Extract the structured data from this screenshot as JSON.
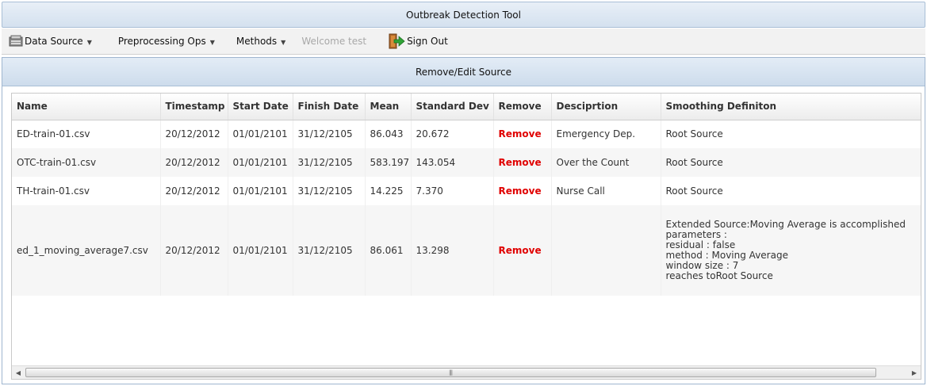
{
  "app": {
    "title": "Outbreak Detection Tool"
  },
  "menu": {
    "data_source": "Data Source",
    "preprocessing": "Preprocessing Ops",
    "methods": "Methods",
    "welcome": "Welcome test",
    "sign_out": "Sign Out",
    "icons": {
      "data_source": "database-icon",
      "sign_out": "exit-door-icon"
    }
  },
  "panel": {
    "title": "Remove/Edit Source"
  },
  "table": {
    "columns": [
      "Name",
      "Timestamp",
      "Start Date",
      "Finish Date",
      "Mean",
      "Standard Dev",
      "Remove",
      "Desciprtion",
      "Smoothing Definiton"
    ],
    "rows": [
      {
        "name": "ED-train-01.csv",
        "timestamp": "20/12/2012",
        "start": "01/01/2101",
        "finish": "31/12/2105",
        "mean": "86.043",
        "std": "20.672",
        "remove": "Remove",
        "description": "Emergency Dep.",
        "smoothing": [
          "Root Source"
        ]
      },
      {
        "name": "OTC-train-01.csv",
        "timestamp": "20/12/2012",
        "start": "01/01/2101",
        "finish": "31/12/2105",
        "mean": "583.197",
        "std": "143.054",
        "remove": "Remove",
        "description": "Over the Count",
        "smoothing": [
          "Root Source"
        ]
      },
      {
        "name": "TH-train-01.csv",
        "timestamp": "20/12/2012",
        "start": "01/01/2101",
        "finish": "31/12/2105",
        "mean": "14.225",
        "std": "7.370",
        "remove": "Remove",
        "description": "Nurse Call",
        "smoothing": [
          "Root Source"
        ]
      },
      {
        "name": "ed_1_moving_average7.csv",
        "timestamp": "20/12/2012",
        "start": "01/01/2101",
        "finish": "31/12/2105",
        "mean": "86.061",
        "std": "13.298",
        "remove": "Remove",
        "description": "",
        "smoothing": [
          "Extended Source:Moving Average is accomplished",
          "parameters :",
          "residual : false",
          "method : Moving Average",
          "window size : 7",
          "reaches toRoot Source"
        ]
      }
    ]
  },
  "colors": {
    "remove_link": "#e00000",
    "header_bg": "#d4e1ef",
    "row_alt": "#f6f6f6"
  }
}
